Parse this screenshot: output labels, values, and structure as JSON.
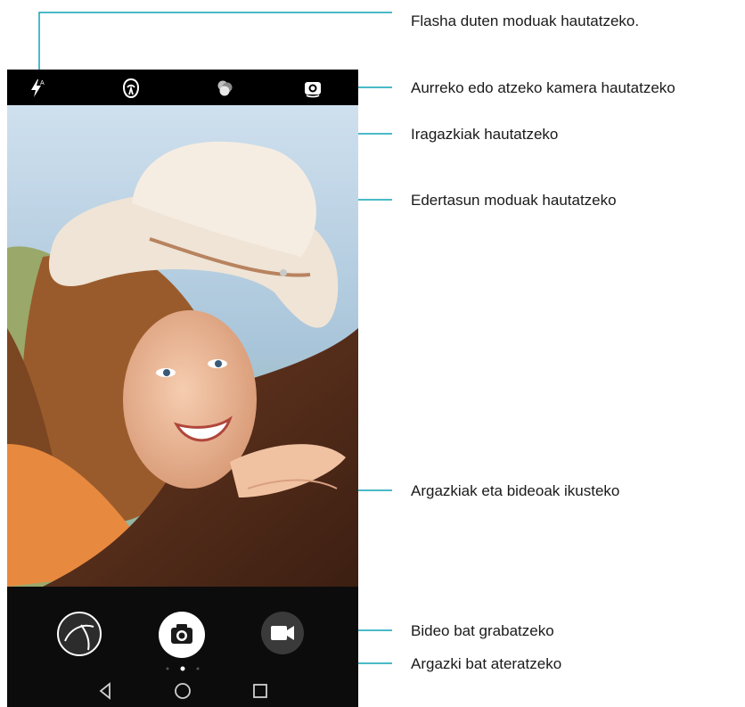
{
  "callouts": {
    "flash": "Flasha duten moduak hautatzeko.",
    "camera_switch": "Aurreko edo atzeko kamera hautatzeko",
    "filters": "Iragazkiak hautatzeko",
    "beauty": "Edertasun moduak hautatzeko",
    "gallery": "Argazkiak eta bideoak ikusteko",
    "video": "Bideo bat grabatzeko",
    "shutter": "Argazki bat ateratzeko"
  },
  "top_icons": [
    "flash-icon",
    "beauty-mode-icon",
    "filters-icon",
    "switch-camera-icon"
  ],
  "bottom_controls": [
    "gallery-thumbnail",
    "shutter-button",
    "video-record-button"
  ],
  "nav_icons": [
    "back-icon",
    "home-icon",
    "recents-icon"
  ],
  "colors": {
    "accent": "#0ea3b5",
    "bar": "#000000"
  }
}
